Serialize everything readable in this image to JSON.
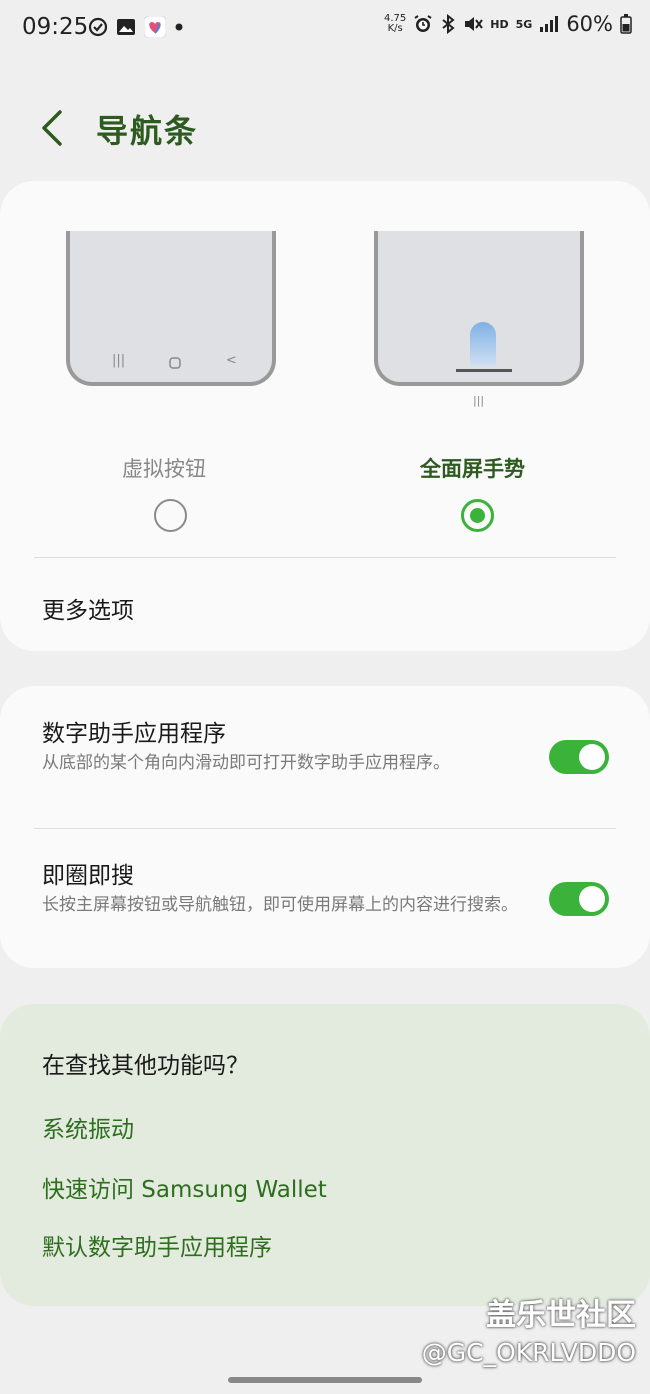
{
  "status_bar": {
    "time": "09:25",
    "net_speed_value": "4.75",
    "net_speed_unit": "K/s",
    "hd_label": "HD",
    "network_label": "5G",
    "battery_text": "60%"
  },
  "header": {
    "title": "导航条"
  },
  "nav_card": {
    "option_virtual_buttons": "虚拟按钮",
    "option_gestures": "全面屏手势",
    "selected": "全面屏手势",
    "more_options": "更多选项"
  },
  "assist_card": {
    "items": [
      {
        "title": "数字助手应用程序",
        "desc": "从底部的某个角向内滑动即可打开数字助手应用程序。",
        "enabled": true
      },
      {
        "title": "即圈即搜",
        "desc": "长按主屏幕按钮或导航触钮，即可使用屏幕上的内容进行搜索。",
        "enabled": true
      }
    ]
  },
  "find_card": {
    "title": "在查找其他功能吗？",
    "links": [
      "系统振动",
      "快速访问 Samsung Wallet",
      "默认数字助手应用程序"
    ]
  },
  "watermark": {
    "line1": "盖乐世社区",
    "line2": "@GC_OKRLVDDO"
  },
  "colors": {
    "accent": "#3bb33b",
    "title_green": "#2d5a1f",
    "link_green": "#2e6e1f",
    "find_bg": "#e2ebdd"
  }
}
